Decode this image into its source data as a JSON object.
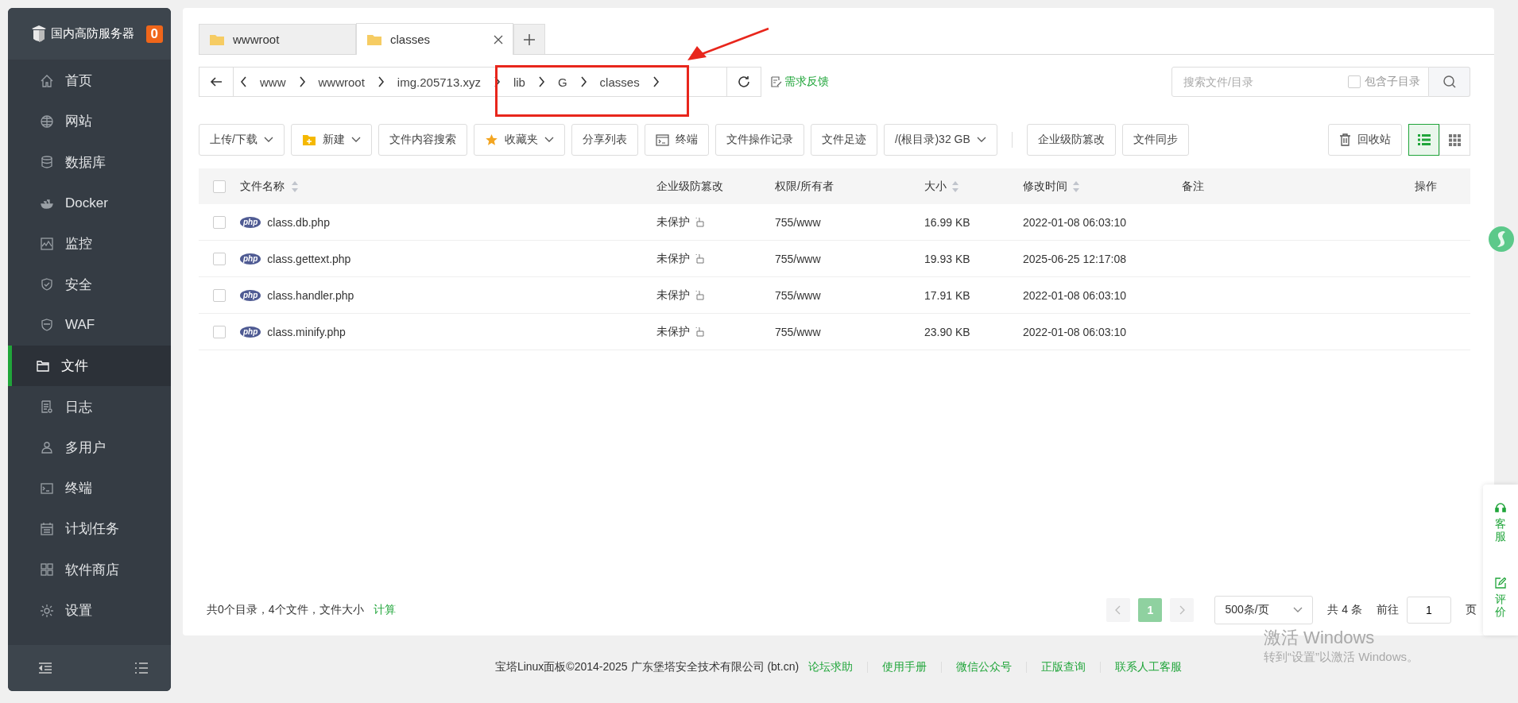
{
  "sidebar": {
    "brand": "国内高防服务器",
    "badge": "0",
    "items": [
      {
        "label": "首页",
        "selected": false
      },
      {
        "label": "网站",
        "selected": false
      },
      {
        "label": "数据库",
        "selected": false
      },
      {
        "label": "Docker",
        "selected": false
      },
      {
        "label": "监控",
        "selected": false
      },
      {
        "label": "安全",
        "selected": false
      },
      {
        "label": "WAF",
        "selected": false
      },
      {
        "label": "文件",
        "selected": true
      },
      {
        "label": "日志",
        "selected": false
      },
      {
        "label": "多用户",
        "selected": false
      },
      {
        "label": "终端",
        "selected": false
      },
      {
        "label": "计划任务",
        "selected": false
      },
      {
        "label": "软件商店",
        "selected": false
      },
      {
        "label": "设置",
        "selected": false
      }
    ]
  },
  "tabs": [
    {
      "label": "wwwroot",
      "selected": false
    },
    {
      "label": "classes",
      "selected": true
    }
  ],
  "breadcrumb": [
    "www",
    "wwwroot",
    "img.205713.xyz",
    "lib",
    "G",
    "classes"
  ],
  "feedback": "需求反馈",
  "search": {
    "placeholder": "搜索文件/目录",
    "subdir_label": "包含子目录",
    "subdir_checked": false
  },
  "toolbar": [
    {
      "label": "上传/下载",
      "kind": "dropdown"
    },
    {
      "label": "新建",
      "kind": "dropdown"
    },
    {
      "label": "文件内容搜索",
      "kind": "plain"
    },
    {
      "label": "收藏夹",
      "kind": "dropdown"
    },
    {
      "label": "分享列表",
      "kind": "plain"
    },
    {
      "label": "终端",
      "kind": "plain"
    },
    {
      "label": "文件操作记录",
      "kind": "plain"
    },
    {
      "label": "文件足迹",
      "kind": "plain"
    },
    {
      "label": "/(根目录)32 GB",
      "kind": "dropdown"
    },
    {
      "label": "企业级防篡改",
      "kind": "plain"
    },
    {
      "label": "文件同步",
      "kind": "plain"
    }
  ],
  "recycle": "回收站",
  "views": [
    {
      "kind": "list",
      "selected": true
    },
    {
      "kind": "grid",
      "selected": false
    }
  ],
  "table": {
    "all_checked": false,
    "columns": [
      {
        "label": "文件名称",
        "sortable": true
      },
      {
        "label": "企业级防篡改",
        "sortable": false
      },
      {
        "label": "权限/所有者",
        "sortable": false
      },
      {
        "label": "大小",
        "sortable": true
      },
      {
        "label": "修改时间",
        "sortable": true
      },
      {
        "label": "备注",
        "sortable": false
      },
      {
        "label": "操作",
        "sortable": false
      }
    ],
    "rows": [
      {
        "type": "php",
        "name": "class.db.php",
        "protect": "未保护",
        "perm": "755/www",
        "size": "16.99 KB",
        "mtime": "2022-01-08 06:03:10",
        "checked": false
      },
      {
        "type": "php",
        "name": "class.gettext.php",
        "protect": "未保护",
        "perm": "755/www",
        "size": "19.93 KB",
        "mtime": "2025-06-25 12:17:08",
        "checked": false
      },
      {
        "type": "php",
        "name": "class.handler.php",
        "protect": "未保护",
        "perm": "755/www",
        "size": "17.91 KB",
        "mtime": "2022-01-08 06:03:10",
        "checked": false
      },
      {
        "type": "php",
        "name": "class.minify.php",
        "protect": "未保护",
        "perm": "755/www",
        "size": "23.90 KB",
        "mtime": "2022-01-08 06:03:10",
        "checked": false
      }
    ]
  },
  "summary": {
    "text": "共0个目录，4个文件，文件大小",
    "link": "计算"
  },
  "pagination": {
    "pages": [
      {
        "label": "1",
        "selected": true
      }
    ],
    "page_size": "500条/页",
    "total": "共 4 条",
    "goto": "前往",
    "goto_value": "1",
    "unit": "页"
  },
  "footer": {
    "copyright": "宝塔Linux面板©2014-2025 广东堡塔安全技术有限公司 (bt.cn)",
    "links": [
      "论坛求助",
      "使用手册",
      "微信公众号",
      "正版查询",
      "联系人工客服"
    ]
  },
  "float_panel": [
    "客服",
    "评价"
  ],
  "os_notice": {
    "title": "激活 Windows",
    "subtitle": "转到“设置”以激活 Windows。"
  }
}
